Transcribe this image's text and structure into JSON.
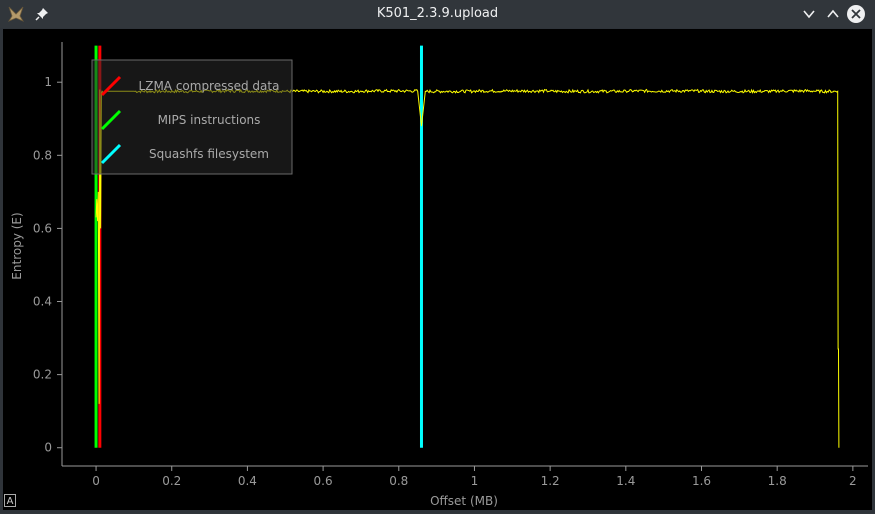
{
  "window": {
    "title": "K501_2.3.9.upload"
  },
  "icons": {
    "app": "binwalk-app-icon",
    "pin": "pin-icon",
    "minimize": "chevron-down-icon",
    "maximize": "chevron-up-icon",
    "close": "close-icon"
  },
  "corner_badge": "A",
  "colors": {
    "entropy": "#ffff00",
    "lzma": "#ff0000",
    "mips": "#00ff00",
    "squashfs": "#00ffff",
    "axis": "#9a9a9a",
    "background": "#000000"
  },
  "chart_data": {
    "type": "line",
    "title": "",
    "xlabel": "Offset (MB)",
    "ylabel": "Entropy (E)",
    "xlim": [
      -0.09,
      2.04
    ],
    "ylim": [
      -0.05,
      1.11
    ],
    "xticks": [
      0,
      0.2,
      0.4,
      0.6,
      0.8,
      1,
      1.2,
      1.4,
      1.6,
      1.8,
      2
    ],
    "xtick_labels": [
      "0",
      "0.2",
      "0.4",
      "0.6",
      "0.8",
      "1",
      "1.2",
      "1.4",
      "1.6",
      "1.8",
      "2"
    ],
    "yticks": [
      0,
      0.2,
      0.4,
      0.6,
      0.8,
      1
    ],
    "ytick_labels": [
      "0",
      "0.2",
      "0.4",
      "0.6",
      "0.8",
      "1"
    ],
    "grid": false,
    "legend_position": "top-left",
    "legend": [
      {
        "label": "LZMA compressed data",
        "color": "#ff0000"
      },
      {
        "label": "MIPS instructions",
        "color": "#00ff00"
      },
      {
        "label": "Squashfs filesystem",
        "color": "#00ffff"
      }
    ],
    "series": [
      {
        "kind": "entropy",
        "color": "#ffff00",
        "x": [
          0.0,
          0.002,
          0.004,
          0.006,
          0.008,
          0.01,
          0.012,
          0.014,
          0.016,
          0.02,
          0.03,
          0.05,
          0.1,
          0.3,
          0.5,
          0.7,
          0.85,
          0.86,
          0.87,
          1.0,
          1.2,
          1.4,
          1.6,
          1.8,
          1.9,
          1.96,
          1.961,
          1.962,
          1.963
        ],
        "y": [
          0.63,
          0.68,
          0.62,
          0.7,
          0.12,
          0.98,
          0.6,
          0.97,
          0.975,
          0.97,
          0.975,
          0.975,
          0.975,
          0.976,
          0.975,
          0.976,
          0.975,
          0.88,
          0.975,
          0.976,
          0.975,
          0.976,
          0.975,
          0.976,
          0.975,
          0.975,
          0.27,
          0.27,
          0.0
        ]
      }
    ],
    "markers": [
      {
        "label": "MIPS instructions",
        "x": 0.0,
        "color": "#00ff00"
      },
      {
        "label": "LZMA compressed data",
        "x": 0.01,
        "color": "#ff0000"
      },
      {
        "label": "Squashfs filesystem",
        "x": 0.86,
        "color": "#00ffff"
      }
    ]
  }
}
